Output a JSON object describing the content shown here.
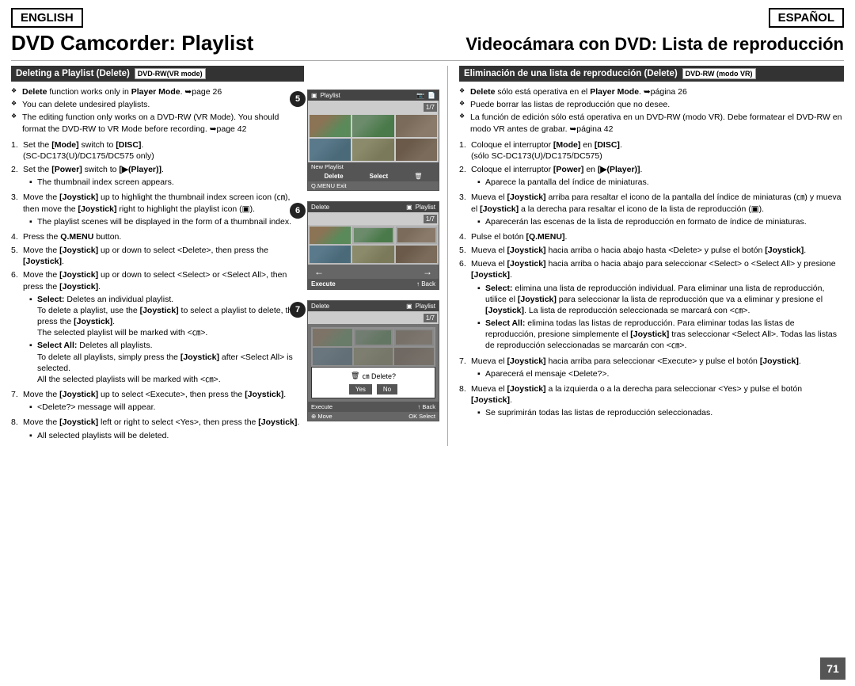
{
  "header": {
    "lang_en": "ENGLISH",
    "lang_es": "ESPAÑOL"
  },
  "title_en": "DVD Camcorder: Playlist",
  "title_es": "Videocámara con DVD: Lista de reproducción",
  "section_en": {
    "heading": "Deleting a Playlist (Delete)",
    "badge": "DVD-RW(VR mode)"
  },
  "section_es": {
    "heading": "Eliminación de una lista de reproducción (Delete)",
    "badge": "DVD-RW (modo VR)"
  },
  "bullets_en": [
    "Delete function works only in Player Mode. ➥page 26",
    "You can delete undesired playlists.",
    "The editing function only works on a DVD-RW (VR Mode). You should format the DVD-RW to VR Mode before recording. ➥page 42"
  ],
  "bullets_es": [
    "Delete sólo está operativa en el Player Mode. ➥página 26",
    "Puede borrar las listas de reproducción que no desee.",
    "La función de edición sólo está operativa en un DVD-RW (modo VR). Debe formatear el DVD-RW en modo VR antes de grabar. ➥página 42"
  ],
  "steps_en": [
    {
      "num": "1.",
      "text": "Set the [Mode] switch to [DISC]. (SC-DC173(U)/DC175/DC575 only)"
    },
    {
      "num": "2.",
      "text": "Set the [Power] switch to [▶(Player)].",
      "sub": [
        "The thumbnail index screen appears."
      ]
    },
    {
      "num": "3.",
      "text": "Move the [Joystick] up to highlight the thumbnail index screen icon (㎝), then move the [Joystick] right to highlight the playlist icon (▣).",
      "sub": [
        "The playlist scenes will be displayed in the form of a thumbnail index."
      ]
    },
    {
      "num": "4.",
      "text": "Press the Q.MENU button."
    },
    {
      "num": "5.",
      "text": "Move the [Joystick] up or down to select <Delete>, then press the [Joystick]."
    },
    {
      "num": "6.",
      "text": "Move the [Joystick] up or down to select <Select> or <Select All>, then press the [Joystick].",
      "sub": [
        "Select: Deletes an individual playlist. To delete a playlist, use the [Joystick] to select a playlist to delete, then press the [Joystick]. The selected playlist will be marked with <㎝>.",
        "Select All: Deletes all playlists. To delete all playlists, simply press the [Joystick] after <Select All> is selected. All the selected playlists will be marked with <㎝>."
      ]
    },
    {
      "num": "7.",
      "text": "Move the [Joystick] up to select <Execute>, then press the [Joystick].",
      "sub": [
        "<Delete?> message will appear."
      ]
    },
    {
      "num": "8.",
      "text": "Move the [Joystick] left or right to select <Yes>, then press the [Joystick].",
      "sub": [
        "All selected playlists will be deleted."
      ]
    }
  ],
  "steps_es": [
    {
      "num": "1.",
      "text": "Coloque el interruptor [Mode] en [DISC]. (sólo SC-DC173(U)/DC175/DC575)"
    },
    {
      "num": "2.",
      "text": "Coloque el interruptor [Power] en [▶(Player)].",
      "sub": [
        "Aparece la pantalla del índice de miniaturas."
      ]
    },
    {
      "num": "3.",
      "text": "Mueva el [Joystick] arriba para resaltar el icono de la pantalla del índice de miniaturas (㎝) y mueva el [Joystick] a la derecha para resaltar el icono de la lista de reproducción (▣).",
      "sub": [
        "Aparecerán las escenas de la lista de reproducción en formato de índice de miniaturas."
      ]
    },
    {
      "num": "4.",
      "text": "Pulse el botón [Q.MENU]."
    },
    {
      "num": "5.",
      "text": "Mueva el [Joystick] hacia arriba o hacia abajo hasta <Delete> y pulse el botón [Joystick]."
    },
    {
      "num": "6.",
      "text": "Mueva el [Joystick] hacia arriba o hacia abajo para seleccionar <Select> o <Select All> y presione [Joystick].",
      "sub": [
        "Select: elimina una lista de reproducción individual. Para eliminar una lista de reproducción, utilice el [Joystick] para seleccionar la lista de reproducción que va a eliminar y presione el [Joystick]. La lista de reproducción seleccionada se marcará con <㎝>.",
        "Select All: elimina todas las listas de reproducción. Para eliminar todas las listas de reproducción, presione simplemente el [Joystick] tras seleccionar <Select All>. Todas las listas de reproducción seleccionadas se marcarán con <㎝>."
      ]
    },
    {
      "num": "7.",
      "text": "Mueva el [Joystick] hacia arriba para seleccionar <Execute> y pulse el botón [Joystick].",
      "sub": [
        "Aparecerá el mensaje <Delete?>."
      ]
    },
    {
      "num": "8.",
      "text": "Mueva el [Joystick] a la izquierda o a la derecha para seleccionar <Yes> y pulse el botón [Joystick].",
      "sub": [
        "Se suprimirán todas las listas de reproducción seleccionadas."
      ]
    }
  ],
  "screens": {
    "screen5": {
      "num": "5",
      "top_label": "Playlist",
      "page": "1/7",
      "bottom_left": "New Playlist",
      "bottom_delete": "Delete",
      "bottom_select": "Select",
      "nav": "Q.MENU Exit"
    },
    "screen6": {
      "num": "6",
      "top_label": "Delete",
      "playlist_label": "Playlist",
      "page": "1/7",
      "bottom_execute": "Execute",
      "bottom_back": "↑ Back"
    },
    "screen7": {
      "num": "7",
      "top_label": "Delete",
      "playlist_label": "Playlist",
      "page": "1/7",
      "execute": "Execute",
      "back": "↑ Back",
      "popup_msg": "㎝ Delete?",
      "btn_yes": "Yes",
      "btn_no": "No",
      "nav_move": "⊕ Move",
      "nav_ok": "OK Select"
    }
  },
  "page_num": "71"
}
